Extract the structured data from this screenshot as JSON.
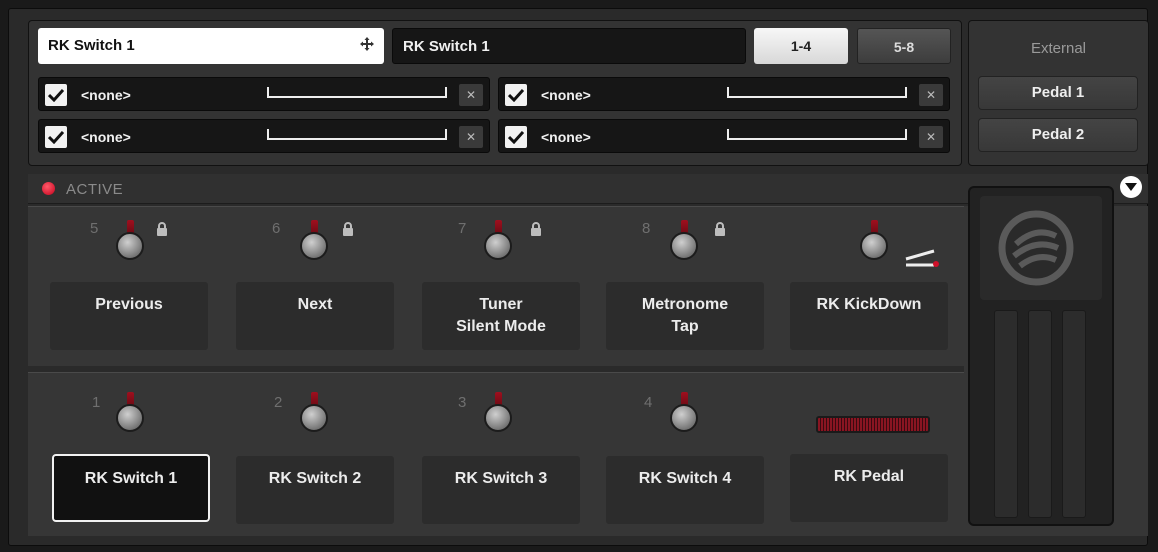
{
  "config": {
    "name_input": "RK Switch 1",
    "name_display": "RK Switch 1",
    "bank_tabs": [
      {
        "label": "1-4",
        "active": true
      },
      {
        "label": "5-8",
        "active": false
      }
    ]
  },
  "assignments": [
    {
      "label": "<none>",
      "checked": true
    },
    {
      "label": "<none>",
      "checked": true
    },
    {
      "label": "<none>",
      "checked": true
    },
    {
      "label": "<none>",
      "checked": true
    }
  ],
  "external": {
    "title": "External",
    "pedals": [
      "Pedal 1",
      "Pedal 2"
    ]
  },
  "status": {
    "label": "ACTIVE",
    "led_color": "#e0102a"
  },
  "top_row": [
    {
      "number": "5",
      "label": "Previous",
      "locked": true
    },
    {
      "number": "6",
      "label": "Next",
      "locked": true
    },
    {
      "number": "7",
      "label": "Tuner\nSilent Mode",
      "locked": true
    },
    {
      "number": "8",
      "label": "Metronome\nTap",
      "locked": true
    },
    {
      "number": "",
      "label": "RK KickDown",
      "locked": false
    }
  ],
  "bottom_row": [
    {
      "number": "1",
      "label": "RK Switch 1",
      "selected": true
    },
    {
      "number": "2",
      "label": "RK Switch 2",
      "selected": false
    },
    {
      "number": "3",
      "label": "RK Switch 3",
      "selected": false
    },
    {
      "number": "4",
      "label": "RK Switch 4",
      "selected": false
    },
    {
      "number": "",
      "label": "RK Pedal",
      "selected": false
    }
  ],
  "icons": {
    "move": "move-icon",
    "check": "check-icon",
    "remove": "close-icon",
    "lock": "lock-icon",
    "dropdown": "chevron-down-icon",
    "kickdown": "kickdown-icon",
    "logo": "rig-kontrol-logo-icon"
  },
  "colors": {
    "accent": "#c4001b",
    "selected_border": "#f2f2f2"
  }
}
